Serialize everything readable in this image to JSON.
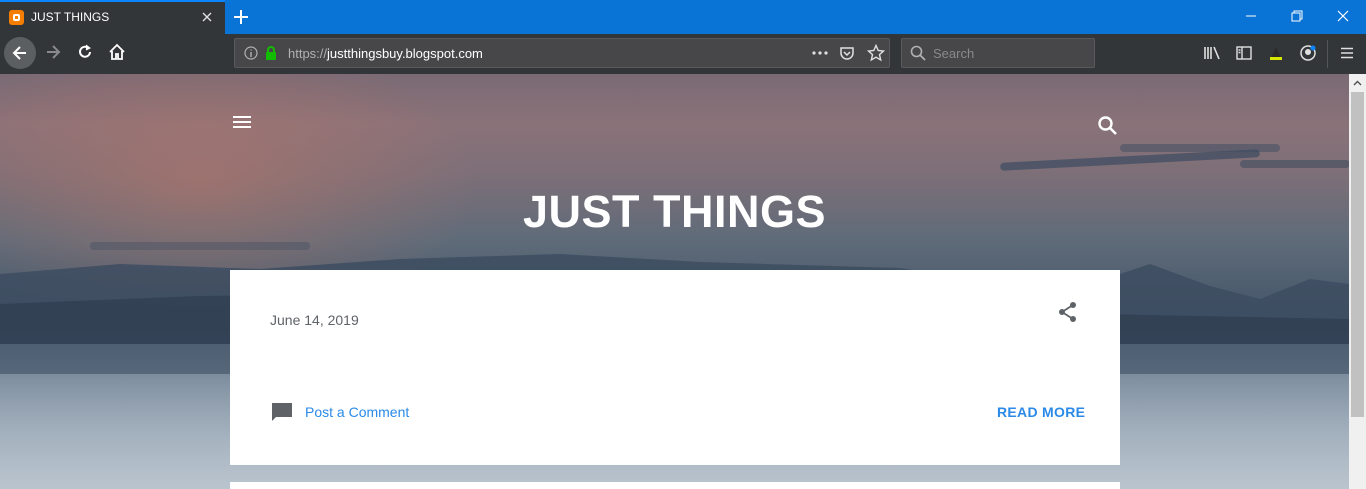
{
  "browser": {
    "tab": {
      "title": "JUST THINGS",
      "favicon": "blogger-icon"
    },
    "url": {
      "prefix": "https://",
      "domain": "justthingsbuy.blogspot.com"
    },
    "search": {
      "placeholder": "Search"
    }
  },
  "blog": {
    "title": "JUST THINGS",
    "post": {
      "date": "June 14, 2019",
      "comment_label": "Post a Comment",
      "read_more_label": "READ MORE"
    }
  },
  "colors": {
    "tab_bar": "#0a74d6",
    "toolbar": "#323639",
    "link": "#2a8ae8",
    "favicon": "#f57d00"
  }
}
